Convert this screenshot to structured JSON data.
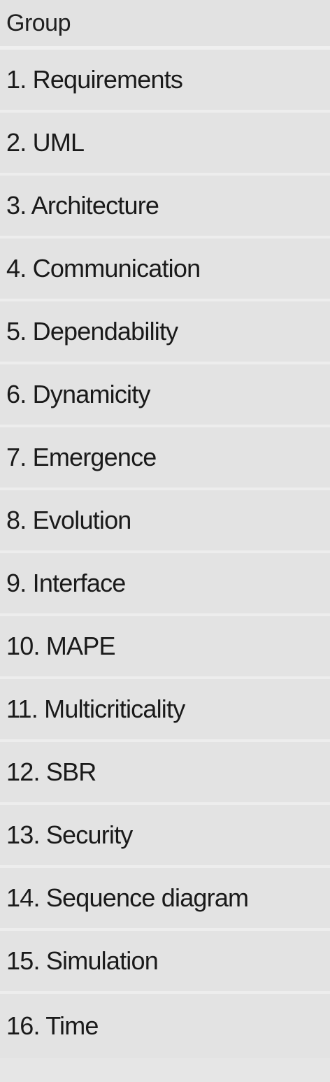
{
  "list": {
    "header": "Group",
    "items": [
      {
        "label": "1. Requirements"
      },
      {
        "label": "2. UML"
      },
      {
        "label": "3. Architecture"
      },
      {
        "label": "4. Communication"
      },
      {
        "label": "5. Dependability"
      },
      {
        "label": "6. Dynamicity"
      },
      {
        "label": "7. Emergence"
      },
      {
        "label": "8. Evolution"
      },
      {
        "label": "9. Interface"
      },
      {
        "label": "10. MAPE"
      },
      {
        "label": "11. Multicriticality"
      },
      {
        "label": "12. SBR"
      },
      {
        "label": "13. Security"
      },
      {
        "label": "14. Sequence diagram"
      },
      {
        "label": "15. Simulation"
      },
      {
        "label": "16. Time"
      }
    ]
  }
}
